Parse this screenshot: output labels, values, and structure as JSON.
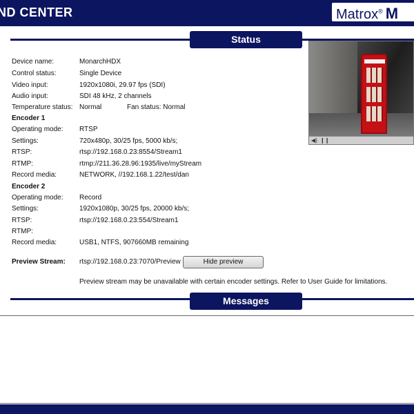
{
  "header": {
    "title": "ND CENTER",
    "logo_text": "Matrox",
    "logo_reg": "®",
    "logo_m": "M"
  },
  "sections": {
    "status": "Status",
    "messages": "Messages"
  },
  "status": {
    "device_name": {
      "label": "Device name:",
      "value": "MonarchHDX"
    },
    "control_status": {
      "label": "Control status:",
      "value": "Single Device"
    },
    "video_input": {
      "label": "Video input:",
      "value": "1920x1080i, 29.97 fps (SDI)"
    },
    "audio_input": {
      "label": "Audio input:",
      "value": "SDI 48 kHz, 2 channels"
    },
    "temperature": {
      "label": "Temperature status:",
      "value": "Normal"
    },
    "fan": {
      "label": "Fan status:",
      "value": "Normal"
    }
  },
  "encoder1": {
    "heading": "Encoder 1",
    "operating_mode": {
      "label": "Operating mode:",
      "value": "RTSP"
    },
    "settings": {
      "label": "Settings:",
      "value": "720x480p, 30/25 fps, 5000 kb/s;"
    },
    "rtsp": {
      "label": "RTSP:",
      "value": "rtsp://192.168.0.23:8554/Stream1"
    },
    "rtmp": {
      "label": "RTMP:",
      "value": "rtmp://211.36.28.96:1935/live/myStream"
    },
    "record_media": {
      "label": "Record media:",
      "value": "NETWORK, //192.168.1.22/test/dan"
    }
  },
  "encoder2": {
    "heading": "Encoder 2",
    "operating_mode": {
      "label": "Operating mode:",
      "value": "Record"
    },
    "settings": {
      "label": "Settings:",
      "value": "1920x1080p, 30/25 fps, 20000 kb/s;"
    },
    "rtsp": {
      "label": "RTSP:",
      "value": "rtsp://192.168.0.23:554/Stream1"
    },
    "rtmp": {
      "label": "RTMP:",
      "value": ""
    },
    "record_media": {
      "label": "Record media:",
      "value": "USB1, NTFS, 907660MB remaining"
    }
  },
  "preview": {
    "label": "Preview Stream:",
    "url": "rtsp://192.168.0.23:7070/Preview",
    "button_label": "Hide preview",
    "note": "Preview stream may be unavailable with certain encoder settings. Refer to User Guide for limitations."
  },
  "video_player": {
    "mute_icon": "speaker-icon",
    "pause_icon": "pause-icon"
  },
  "colors": {
    "brand": "#0c1560",
    "phonebox": "#c51015"
  }
}
